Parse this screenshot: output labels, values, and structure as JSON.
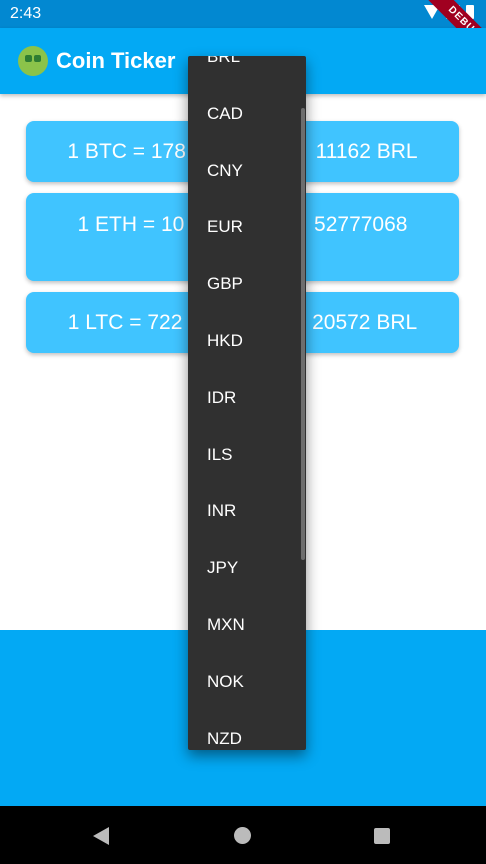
{
  "status_bar": {
    "time": "2:43",
    "debug_label": "DEBUG"
  },
  "app_bar": {
    "emoji_icon": "money-mouth-face-icon",
    "title": "Coin Ticker"
  },
  "rates": {
    "btc": "1 BTC = 178",
    "btc_tail": "11162 BRL",
    "eth": "1 ETH = 10",
    "eth_tail": "52777068",
    "ltc": "1 LTC = 722",
    "ltc_tail": "20572 BRL"
  },
  "dropdown": {
    "items": [
      "BRL",
      "CAD",
      "CNY",
      "EUR",
      "GBP",
      "HKD",
      "IDR",
      "ILS",
      "INR",
      "JPY",
      "MXN",
      "NOK",
      "NZD"
    ]
  },
  "colors": {
    "app_bar": "#03a9f4",
    "status_bar": "#0288d1",
    "card": "#40c4ff",
    "dropdown": "#303030"
  }
}
